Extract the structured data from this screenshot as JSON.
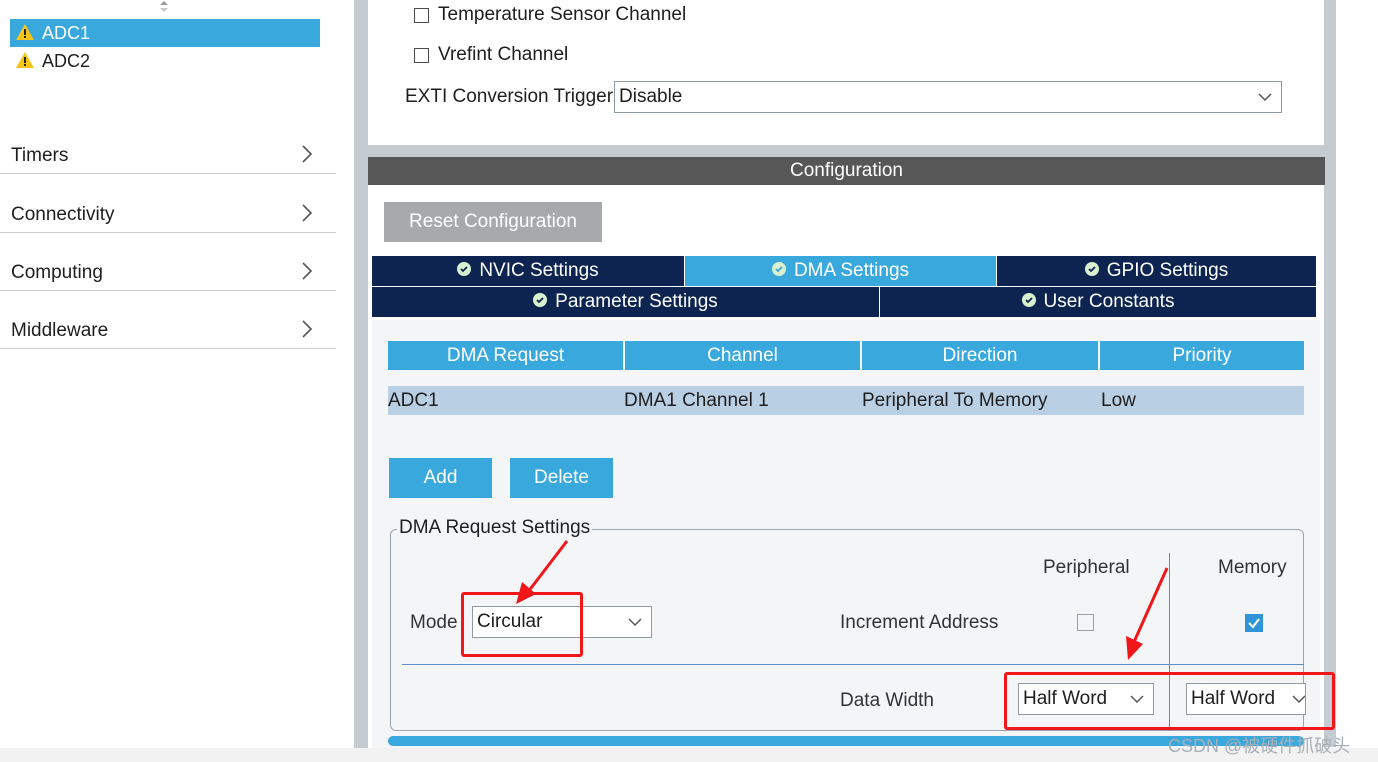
{
  "sidebar": {
    "adc_items": [
      {
        "label": "ADC1",
        "selected": true,
        "icon": "warning-icon"
      },
      {
        "label": "ADC2",
        "selected": false,
        "icon": "warning-icon"
      }
    ],
    "categories": [
      {
        "label": "Timers",
        "icon": "chevron-right-icon"
      },
      {
        "label": "Connectivity",
        "icon": "chevron-right-icon"
      },
      {
        "label": "Computing",
        "icon": "chevron-right-icon"
      },
      {
        "label": "Middleware",
        "icon": "chevron-right-icon"
      }
    ]
  },
  "mode": {
    "temp_sensor_label": "Temperature Sensor Channel",
    "temp_sensor_checked": false,
    "vrefint_label": "Vrefint Channel",
    "vrefint_checked": false,
    "exti_label": "EXTI Conversion Trigger",
    "exti_value": "Disable"
  },
  "configuration": {
    "header": "Configuration",
    "reset_button": "Reset Configuration",
    "tabs_row1": [
      {
        "label": "NVIC Settings",
        "active": false
      },
      {
        "label": "DMA Settings",
        "active": true
      },
      {
        "label": "GPIO Settings",
        "active": false
      }
    ],
    "tabs_row2": [
      {
        "label": "Parameter Settings",
        "active": false
      },
      {
        "label": "User Constants",
        "active": false
      }
    ]
  },
  "dma_table": {
    "columns": [
      "DMA Request",
      "Channel",
      "Direction",
      "Priority"
    ],
    "rows": [
      [
        "ADC1",
        "DMA1 Channel 1",
        "Peripheral To Memory",
        "Low"
      ]
    ]
  },
  "buttons": {
    "add": "Add",
    "delete": "Delete"
  },
  "request_settings": {
    "legend": "DMA Request Settings",
    "mode_label": "Mode",
    "mode_value": "Circular",
    "peripheral_header": "Peripheral",
    "memory_header": "Memory",
    "increment_label": "Increment Address",
    "peripheral_increment": false,
    "memory_increment": true,
    "data_width_label": "Data Width",
    "peripheral_width": "Half Word",
    "memory_width": "Half Word"
  },
  "watermark": "CSDN @被硬件抓破头",
  "colors": {
    "accent": "#39a8dc",
    "tab_dark": "#0c244f",
    "header_gray": "#575757",
    "annotation_red": "#f0161a"
  }
}
